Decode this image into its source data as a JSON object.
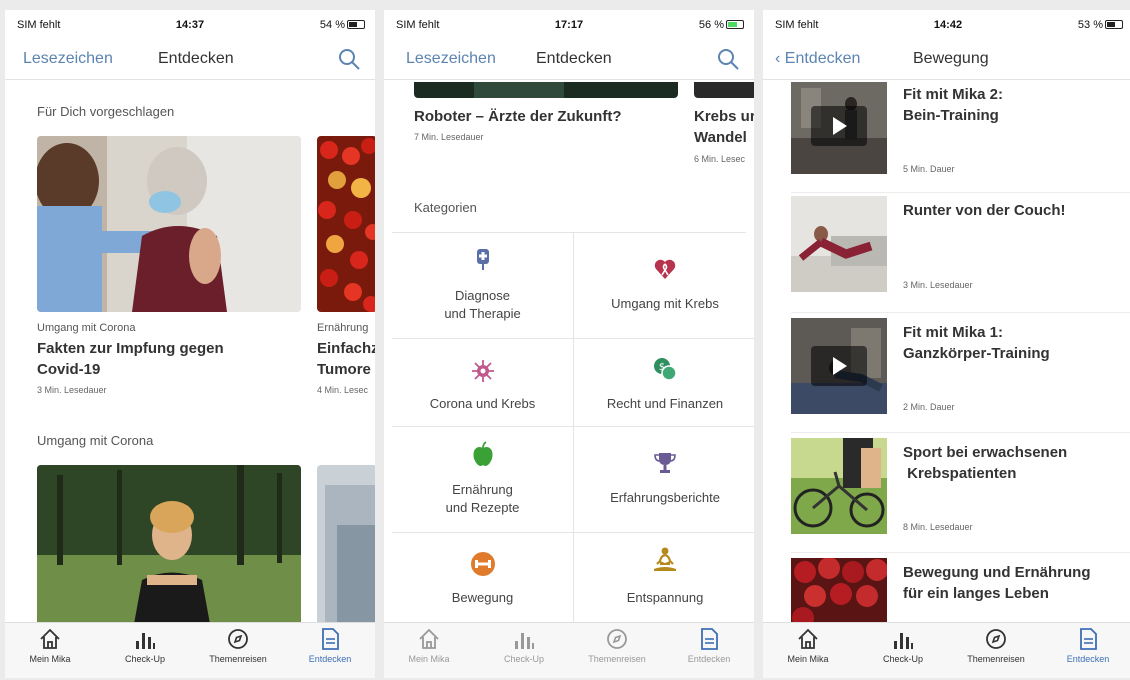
{
  "screens": [
    {
      "status": {
        "carrier": "SIM fehlt",
        "time": "14:37",
        "battery": "54 %"
      },
      "nav": {
        "left": "Lesezeichen",
        "title": "Entdecken"
      },
      "sections": [
        {
          "title": "Für Dich vorgeschlagen",
          "cards": [
            {
              "category": "Umgang mit Corona",
              "title_line1": "Fakten zur Impfung gegen",
              "title_line2": "Covid-19",
              "meta": "3 Min. Lesedauer"
            },
            {
              "category": "Ernährung",
              "title_line1": "Einfachz",
              "title_line2": "Tumore",
              "meta": "4 Min. Lesec"
            }
          ]
        },
        {
          "title": "Umgang mit Corona"
        }
      ]
    },
    {
      "status": {
        "carrier": "SIM fehlt",
        "time": "17:17",
        "battery": "56 %"
      },
      "nav": {
        "left": "Lesezeichen",
        "title": "Entdecken"
      },
      "cards": [
        {
          "title": "Roboter – Ärzte der Zukunft?",
          "meta": "7 Min. Lesedauer"
        },
        {
          "title_line1": "Krebs ur",
          "title_line2": "Wandel",
          "meta": "6 Min. Lesec"
        }
      ],
      "categories_title": "Kategorien",
      "categories": [
        {
          "line1": "Diagnose",
          "line2": "und Therapie",
          "icon": "iv-bag-icon",
          "color": "#5a6fa8"
        },
        {
          "line1": "Umgang mit Krebs",
          "line2": "",
          "icon": "heart-ribbon-icon",
          "color": "#b8334e"
        },
        {
          "line1": "Corona und Krebs",
          "line2": "",
          "icon": "virus-icon",
          "color": "#c05a8c"
        },
        {
          "line1": "Recht und Finanzen",
          "line2": "",
          "icon": "money-icon",
          "color": "#2f8f5f"
        },
        {
          "line1": "Ernährung",
          "line2": "und Rezepte",
          "icon": "apple-icon",
          "color": "#3aa136"
        },
        {
          "line1": "Erfahrungsberichte",
          "line2": "",
          "icon": "trophy-icon",
          "color": "#6b5b95"
        },
        {
          "line1": "Bewegung",
          "line2": "",
          "icon": "dumbbell-icon",
          "color": "#e07b2c"
        },
        {
          "line1": "Entspannung",
          "line2": "",
          "icon": "meditation-icon",
          "color": "#b58a1c"
        }
      ]
    },
    {
      "status": {
        "carrier": "SIM fehlt",
        "time": "14:42",
        "battery": "53 %"
      },
      "nav": {
        "back": "Entdecken",
        "title": "Bewegung"
      },
      "items": [
        {
          "line1": "Fit mit Mika 2:",
          "line2": "Bein-Training",
          "meta": "5 Min. Dauer",
          "video": true
        },
        {
          "line1": "Runter von der Couch!",
          "line2": "",
          "meta": "3 Min. Lesedauer",
          "video": false
        },
        {
          "line1": "Fit mit Mika 1:",
          "line2": "Ganzkörper-Training",
          "meta": "2 Min. Dauer",
          "video": true
        },
        {
          "line1": "Sport bei erwachsenen",
          "line2": " Krebspatienten",
          "meta": "8 Min. Lesedauer",
          "video": false
        },
        {
          "line1": "Bewegung und Ernährung",
          "line2": "für ein langes Leben",
          "meta": "",
          "video": false
        }
      ]
    }
  ],
  "tabs": [
    {
      "label": "Mein Mika",
      "icon": "home-icon"
    },
    {
      "label": "Check-Up",
      "icon": "bar-chart-icon"
    },
    {
      "label": "Themenreisen",
      "icon": "compass-icon"
    },
    {
      "label": "Entdecken",
      "icon": "document-icon"
    }
  ],
  "colors": {
    "accent": "#3d6fb5",
    "link": "#5b84b1"
  }
}
